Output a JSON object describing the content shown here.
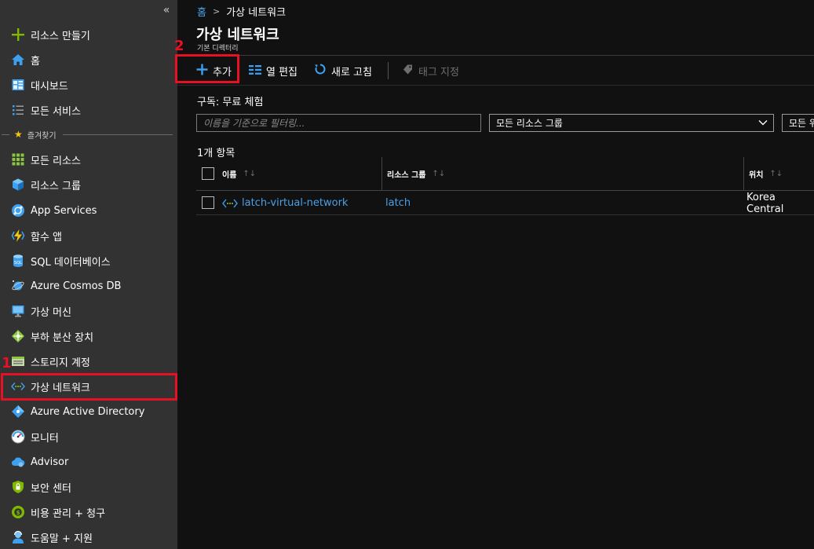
{
  "sidebar": {
    "collapse_glyph": "«",
    "create_resource": "리소스 만들기",
    "items_top": [
      {
        "label": "홈",
        "icon": "home-icon"
      },
      {
        "label": "대시보드",
        "icon": "dashboard-icon"
      },
      {
        "label": "모든 서비스",
        "icon": "list-icon"
      }
    ],
    "favorites_label": "즐겨찾기",
    "favorites": [
      {
        "label": "모든 리소스",
        "icon": "grid-icon"
      },
      {
        "label": "리소스 그룹",
        "icon": "cube-icon"
      },
      {
        "label": "App Services",
        "icon": "app-services-icon"
      },
      {
        "label": "함수 앱",
        "icon": "bolt-icon"
      },
      {
        "label": "SQL 데이터베이스",
        "icon": "sql-database-icon"
      },
      {
        "label": "Azure Cosmos DB",
        "icon": "cosmos-db-icon"
      },
      {
        "label": "가상 머신",
        "icon": "virtual-machine-icon"
      },
      {
        "label": "부하 분산 장치",
        "icon": "load-balancer-icon"
      },
      {
        "label": "스토리지 계정",
        "icon": "storage-icon"
      },
      {
        "label": "가상 네트워크",
        "icon": "virtual-network-icon"
      },
      {
        "label": "Azure Active Directory",
        "icon": "active-directory-icon"
      },
      {
        "label": "모니터",
        "icon": "monitor-gauge-icon"
      },
      {
        "label": "Advisor",
        "icon": "advisor-cloud-icon"
      },
      {
        "label": "보안 센터",
        "icon": "shield-icon"
      },
      {
        "label": "비용 관리 + 청구",
        "icon": "cost-icon"
      },
      {
        "label": "도움말 + 지원",
        "icon": "support-icon"
      }
    ]
  },
  "annotations": {
    "one": "1",
    "two": "2"
  },
  "breadcrumb": {
    "home": "홈",
    "separator": ">",
    "current": "가상 네트워크"
  },
  "page": {
    "title": "가상 네트워크",
    "subtitle": "기본 디렉터리"
  },
  "toolbar": {
    "add": "추가",
    "edit_columns": "열 편집",
    "refresh": "새로 고침",
    "assign_tags": "태그 지정"
  },
  "subscription": "구독: 무료 체험",
  "filter": {
    "placeholder": "이름을 기준으로 필터링..."
  },
  "resource_group_select": "모든 리소스 그룹",
  "location_select": "모든 위치",
  "count_text": "1개 항목",
  "table": {
    "headers": {
      "name": "이름",
      "resource_group": "리소스 그룹",
      "location": "위치"
    },
    "sort_glyph": "↑↓",
    "rows": [
      {
        "name": "latch-virtual-network",
        "resource_group": "latch",
        "location": "Korea Central"
      }
    ]
  },
  "colors": {
    "accent": "#4aa0e6",
    "annotation": "#e81123",
    "sidebar_bg": "#323232",
    "main_bg": "#111111"
  }
}
